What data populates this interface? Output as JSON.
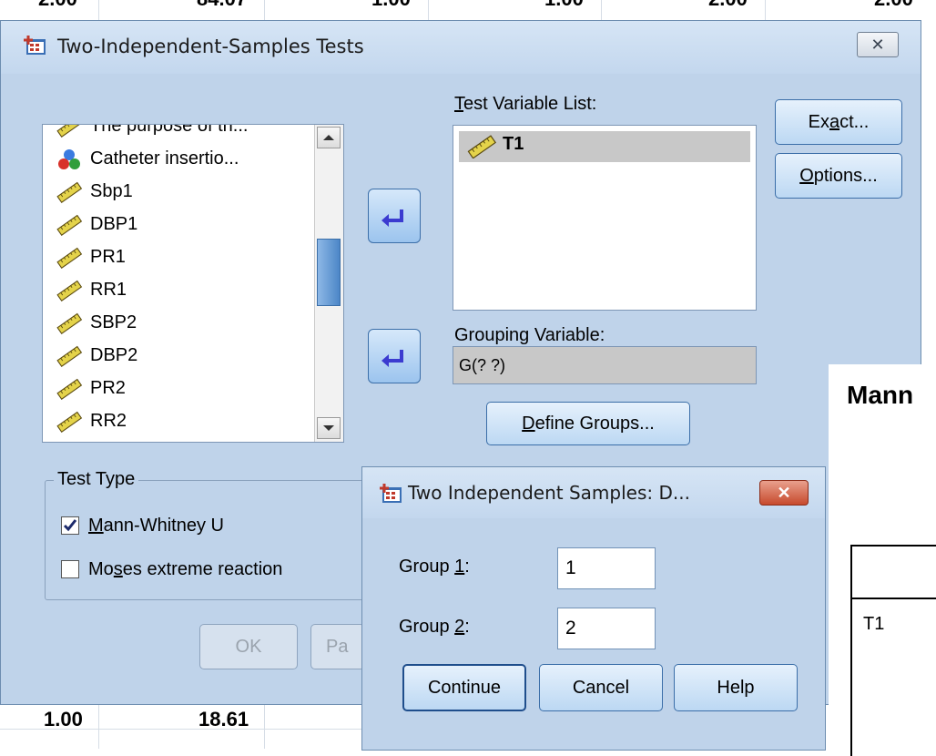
{
  "background": {
    "top_cells": [
      "2.00",
      "84.07",
      "1.00",
      "1.00",
      "2.00",
      "2.00"
    ],
    "bottom_cells": [
      "1.00",
      "18.61"
    ]
  },
  "dialog": {
    "title": "Two-Independent-Samples Tests",
    "close_glyph": "✕",
    "variables": [
      {
        "label": "The purpose of th...",
        "icon": "ruler-icon"
      },
      {
        "label": "Catheter insertio...",
        "icon": "nominal-icon"
      },
      {
        "label": "Sbp1",
        "icon": "ruler-icon"
      },
      {
        "label": "DBP1",
        "icon": "ruler-icon"
      },
      {
        "label": "PR1",
        "icon": "ruler-icon"
      },
      {
        "label": "RR1",
        "icon": "ruler-icon"
      },
      {
        "label": "SBP2",
        "icon": "ruler-icon"
      },
      {
        "label": "DBP2",
        "icon": "ruler-icon"
      },
      {
        "label": "PR2",
        "icon": "ruler-icon"
      },
      {
        "label": "RR2",
        "icon": "ruler-icon"
      }
    ],
    "test_variable_list": {
      "label_pre": "",
      "label_u": "T",
      "label_post": "est Variable List:",
      "items": [
        "T1"
      ]
    },
    "grouping_variable": {
      "label": "Grouping Variable:",
      "value": "G(? ?)"
    },
    "define_groups": {
      "pre": "",
      "u": "D",
      "post": "efine Groups..."
    },
    "exact": {
      "pre": "Ex",
      "u": "a",
      "post": "ct..."
    },
    "options": {
      "pre": "",
      "u": "O",
      "post": "ptions..."
    },
    "test_type": {
      "title": "Test Type",
      "mann_whitney": {
        "pre": "",
        "u": "M",
        "post": "ann-Whitney U",
        "checked": true
      },
      "moses": {
        "pre": "Mo",
        "u": "s",
        "post": "es extreme reaction",
        "checked": false
      }
    },
    "ok_label": "OK",
    "paste_label": "Pa"
  },
  "subdialog": {
    "title": "Two Independent Samples: D...",
    "close_glyph": "✕",
    "group1": {
      "pre": "Group ",
      "u": "1",
      "post": ":",
      "value": "1"
    },
    "group2": {
      "pre": "Group ",
      "u": "2",
      "post": ":",
      "value": "2"
    },
    "continue_label": "Continue",
    "cancel_label": "Cancel",
    "help_label": "Help"
  },
  "output": {
    "heading": "Mann",
    "row_label": "T1"
  },
  "colors": {
    "dialog_bg": "#bfd3ea",
    "button_border": "#3b6ea8",
    "selection_gray": "#c8c8c8",
    "close_red": "#c74a2d"
  }
}
